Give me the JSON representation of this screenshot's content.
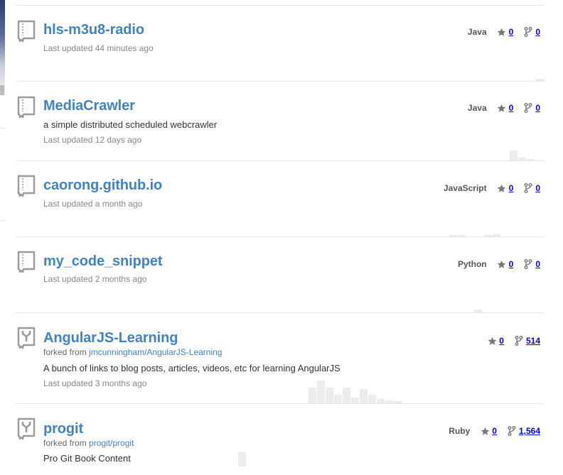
{
  "colors": {
    "link": "#4183c4",
    "muted": "#888888",
    "rule": "#e5e5e5",
    "graph": "#ececec"
  },
  "repos": [
    {
      "name": "hls-m3u8-radio",
      "icon": "repo-icon",
      "description": "",
      "forked_from_label": "",
      "forked_from": "",
      "updated": "Last updated 44 minutes ago",
      "language": "Java",
      "stars": "0",
      "forks": "0"
    },
    {
      "name": "MediaCrawler",
      "icon": "repo-icon",
      "description": "a simple distributed scheduled webcrawler",
      "forked_from_label": "",
      "forked_from": "",
      "updated": "Last updated 12 days ago",
      "language": "Java",
      "stars": "0",
      "forks": "0"
    },
    {
      "name": "caorong.github.io",
      "icon": "repo-icon",
      "description": "",
      "forked_from_label": "",
      "forked_from": "",
      "updated": "Last updated a month ago",
      "language": "JavaScript",
      "stars": "0",
      "forks": "0"
    },
    {
      "name": "my_code_snippet",
      "icon": "repo-icon",
      "description": "",
      "forked_from_label": "",
      "forked_from": "",
      "updated": "Last updated 2 months ago",
      "language": "Python",
      "stars": "0",
      "forks": "0"
    },
    {
      "name": "AngularJS-Learning",
      "icon": "fork-repo-icon",
      "description": "A bunch of links to blog posts, articles, videos, etc for learning AngularJS",
      "forked_from_label": "forked from",
      "forked_from": "jmcunningham/AngularJS-Learning",
      "updated": "Last updated 3 months ago",
      "language": "",
      "stars": "0",
      "forks": "514"
    },
    {
      "name": "progit",
      "icon": "fork-repo-icon",
      "description": "Pro Git Book Content",
      "forked_from_label": "forked from",
      "forked_from": "progit/progit",
      "updated": "",
      "language": "Ruby",
      "stars": "0",
      "forks": "1,564"
    }
  ]
}
